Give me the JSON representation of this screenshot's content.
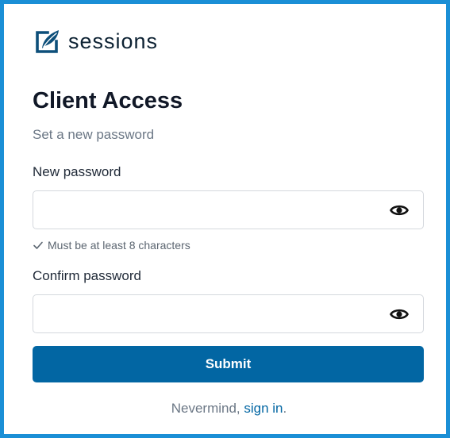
{
  "brand": {
    "name": "sessions",
    "logo_icon": "sessions-feather-logo",
    "accent_color": "#0266a3",
    "frame_color": "#1a8fd6"
  },
  "page": {
    "title": "Client Access",
    "subtitle": "Set a new password"
  },
  "form": {
    "new_password": {
      "label": "New password",
      "value": "",
      "toggle_icon": "eye-icon",
      "hint": "Must be at least 8 characters",
      "hint_icon": "checkmark-icon"
    },
    "confirm_password": {
      "label": "Confirm password",
      "value": "",
      "toggle_icon": "eye-icon"
    },
    "submit_label": "Submit"
  },
  "footer": {
    "prefix": "Nevermind, ",
    "link_text": "sign in",
    "suffix": "."
  }
}
